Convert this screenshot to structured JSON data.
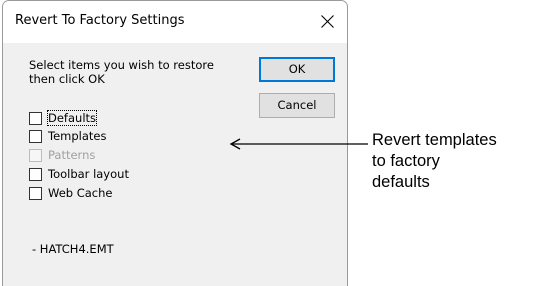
{
  "dialog": {
    "title": "Revert To Factory Settings",
    "close_icon": "close-icon",
    "instruction": "Select items you wish to restore\nthen click OK",
    "ok_label": "OK",
    "cancel_label": "Cancel",
    "items": [
      {
        "label": "Defaults",
        "checked": false,
        "enabled": true,
        "focused": true
      },
      {
        "label": "Templates",
        "checked": false,
        "enabled": true,
        "focused": false
      },
      {
        "label": "Patterns",
        "checked": false,
        "enabled": false,
        "focused": false
      },
      {
        "label": "Toolbar layout",
        "checked": false,
        "enabled": true,
        "focused": false
      },
      {
        "label": "Web Cache",
        "checked": false,
        "enabled": true,
        "focused": false
      }
    ],
    "filename": "- HATCH4.EMT"
  },
  "annotation": {
    "text": "Revert templates\nto factory\ndefaults",
    "arrow_icon": "left-arrow-icon"
  }
}
